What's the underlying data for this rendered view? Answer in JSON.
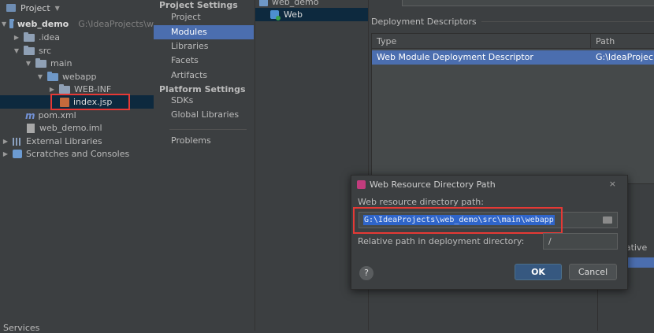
{
  "project_panel": {
    "title": "Project",
    "tree": [
      {
        "label": "web_demo",
        "path": "G:\\IdeaProjects\\w"
      },
      {
        "label": ".idea"
      },
      {
        "label": "src"
      },
      {
        "label": "main"
      },
      {
        "label": "webapp"
      },
      {
        "label": "WEB-INF"
      },
      {
        "label": "index.jsp"
      },
      {
        "label": "pom.xml"
      },
      {
        "label": "web_demo.iml"
      },
      {
        "label": "External Libraries"
      },
      {
        "label": "Scratches and Consoles"
      }
    ],
    "services_label": "Services"
  },
  "sidebar": {
    "project_settings_heading": "Project Settings",
    "project_settings": [
      "Project",
      "Modules",
      "Libraries",
      "Facets",
      "Artifacts"
    ],
    "platform_settings_heading": "Platform Settings",
    "platform_settings": [
      "SDKs",
      "Global Libraries"
    ],
    "problems": "Problems"
  },
  "module_tree": {
    "module": "web_demo",
    "facet": "Web"
  },
  "deployment": {
    "title": "Deployment Descriptors",
    "columns": [
      "Type",
      "Path"
    ],
    "row": {
      "type": "Web Module Deployment Descriptor",
      "path": "G:\\IdeaProjec"
    },
    "relative_label": "elative"
  },
  "dialog": {
    "title": "Web Resource Directory Path",
    "close": "×",
    "path_label": "Web resource directory path:",
    "path_value": "G:\\IdeaProjects\\web_demo\\src\\main\\webapp",
    "relative_label": "Relative path in deployment directory:",
    "relative_value": "/",
    "help": "?",
    "ok": "OK",
    "cancel": "Cancel"
  }
}
